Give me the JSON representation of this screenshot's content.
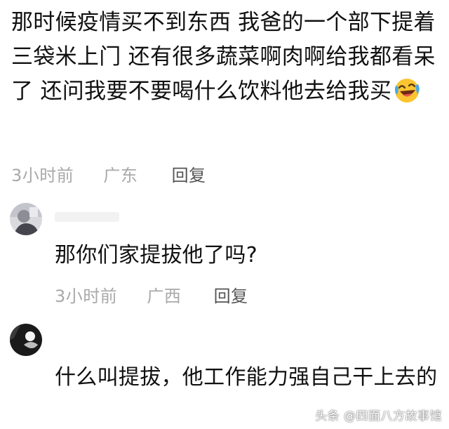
{
  "main_comment": {
    "text": "那时候疫情买不到东西 我爸的一个部下提着三袋米上门 还有很多蔬菜啊肉啊给我都看呆了 还问我要不要喝什么饮料他去给我买",
    "emoji": "laughing-with-tears-emoji",
    "time": "3小时前",
    "location": "广东",
    "reply_label": "回复"
  },
  "replies": [
    {
      "text": "那你们家提拔他了吗?",
      "time": "3小时前",
      "location": "广西",
      "reply_label": "回复"
    },
    {
      "text": "什么叫提拔，他工作能力强自己干上去的"
    }
  ],
  "watermark": "头条 @四面八方故事馆",
  "colors": {
    "text": "#111111",
    "meta": "#a9a9a9",
    "reply_link": "#555555",
    "emoji_face": "#fbc531"
  }
}
